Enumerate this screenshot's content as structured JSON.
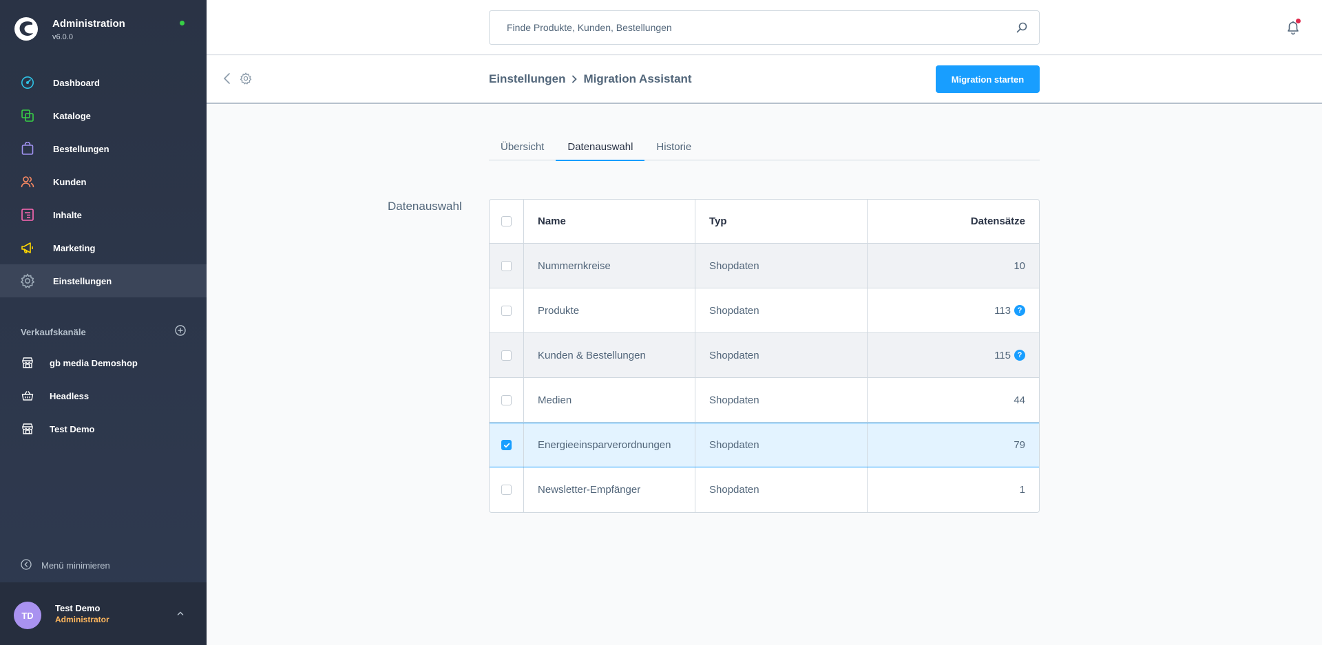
{
  "app": {
    "title": "Administration",
    "version": "v6.0.0",
    "status_color": "#37d046"
  },
  "nav": {
    "items": [
      {
        "label": "Dashboard",
        "icon": "dashboard-icon",
        "color": "#2ec2e5"
      },
      {
        "label": "Kataloge",
        "icon": "catalog-icon",
        "color": "#37d046"
      },
      {
        "label": "Bestellungen",
        "icon": "shopping-bag-icon",
        "color": "#a092f0"
      },
      {
        "label": "Kunden",
        "icon": "customers-icon",
        "color": "#f88962"
      },
      {
        "label": "Inhalte",
        "icon": "content-icon",
        "color": "#ff68b4"
      },
      {
        "label": "Marketing",
        "icon": "megaphone-icon",
        "color": "#ffd700"
      },
      {
        "label": "Einstellungen",
        "icon": "gear-icon",
        "color": "#9aa8b5",
        "active": true
      }
    ]
  },
  "sales_channels": {
    "title": "Verkaufskanäle",
    "items": [
      {
        "label": "gb media Demoshop",
        "icon": "storefront-icon"
      },
      {
        "label": "Headless",
        "icon": "basket-icon"
      },
      {
        "label": "Test Demo",
        "icon": "storefront-icon"
      }
    ]
  },
  "sidebar_footer": {
    "minimize_label": "Menü minimieren"
  },
  "user": {
    "initials": "TD",
    "name": "Test Demo",
    "role": "Administrator"
  },
  "search": {
    "placeholder": "Finde Produkte, Kunden, Bestellungen"
  },
  "breadcrumb": {
    "parent": "Einstellungen",
    "current": "Migration Assistant"
  },
  "actions": {
    "primary_label": "Migration starten"
  },
  "tabs": [
    {
      "label": "Übersicht",
      "active": false
    },
    {
      "label": "Datenauswahl",
      "active": true
    },
    {
      "label": "Historie",
      "active": false
    }
  ],
  "section": {
    "label": "Datenauswahl"
  },
  "table": {
    "columns": {
      "name": "Name",
      "type": "Typ",
      "count": "Datensätze"
    },
    "rows": [
      {
        "name": "Nummernkreise",
        "type": "Shopdaten",
        "count": "10",
        "help": false,
        "checked": false
      },
      {
        "name": "Produkte",
        "type": "Shopdaten",
        "count": "113",
        "help": true,
        "checked": false
      },
      {
        "name": "Kunden & Bestellungen",
        "type": "Shopdaten",
        "count": "115",
        "help": true,
        "checked": false
      },
      {
        "name": "Medien",
        "type": "Shopdaten",
        "count": "44",
        "help": false,
        "checked": false
      },
      {
        "name": "Energieeinsparverordnungen",
        "type": "Shopdaten",
        "count": "79",
        "help": false,
        "checked": true
      },
      {
        "name": "Newsletter-Empfänger",
        "type": "Shopdaten",
        "count": "1",
        "help": false,
        "checked": false
      }
    ]
  },
  "colors": {
    "accent": "#189eff",
    "sidebar": "#2a3345",
    "user_role": "#ffb75d",
    "notification": "#de294c"
  }
}
